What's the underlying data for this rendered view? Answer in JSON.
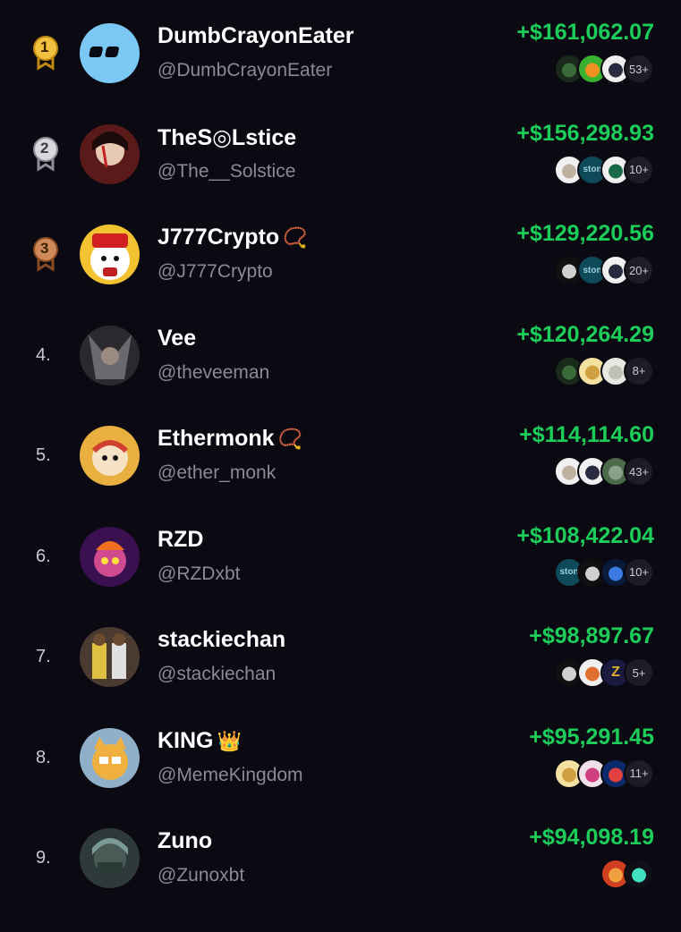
{
  "leaderboard": [
    {
      "rank": "1",
      "medal": "gold",
      "name": "DumbCrayonEater",
      "emoji": "",
      "handle": "@DumbCrayonEater",
      "pnl": "+$161,062.07",
      "avatar_color": "#7cc8f5",
      "tokens": [
        "dark-green-token-icon",
        "orange-green-token-icon",
        "cat-token-icon"
      ],
      "more": "53+"
    },
    {
      "rank": "2",
      "medal": "silver",
      "name": "TheS◎Lstice",
      "emoji": "",
      "handle": "@The__Solstice",
      "pnl": "+$156,298.93",
      "avatar_color": "#5a1a1a",
      "tokens": [
        "cat-white-token-icon",
        "ston-token-icon",
        "starbucks-cat-token-icon"
      ],
      "more": "10+"
    },
    {
      "rank": "3",
      "medal": "bronze",
      "name": "J777Crypto",
      "emoji": "📿",
      "handle": "@J777Crypto",
      "pnl": "+$129,220.56",
      "avatar_color": "#f2c230",
      "tokens": [
        "dark-figure-token-icon",
        "ston-token-icon",
        "cat-token-icon"
      ],
      "more": "20+"
    },
    {
      "rank": "4.",
      "medal": "",
      "name": "Vee",
      "emoji": "",
      "handle": "@theveeman",
      "pnl": "+$120,264.29",
      "avatar_color": "#2a2a2e",
      "tokens": [
        "dark-green-token-icon",
        "yellow-face-token-icon",
        "ghost-token-icon"
      ],
      "more": "8+"
    },
    {
      "rank": "5.",
      "medal": "",
      "name": "Ethermonk",
      "emoji": "📿",
      "handle": "@ether_monk",
      "pnl": "+$114,114.60",
      "avatar_color": "#e9b040",
      "tokens": [
        "cat-white-token-icon",
        "cat-token-icon",
        "green-frog-token-icon"
      ],
      "more": "43+"
    },
    {
      "rank": "6.",
      "medal": "",
      "name": "RZD",
      "emoji": "",
      "handle": "@RZDxbt",
      "pnl": "+$108,422.04",
      "avatar_color": "#3a1050",
      "tokens": [
        "ston-token-icon",
        "dark-figure-token-icon",
        "blue-figure-token-icon"
      ],
      "more": "10+"
    },
    {
      "rank": "7.",
      "medal": "",
      "name": "stackiechan",
      "emoji": "",
      "handle": "@stackiechan",
      "pnl": "+$98,897.67",
      "avatar_color": "#4a3a30",
      "tokens": [
        "dark-figure-token-icon",
        "orange-dog-token-icon",
        "gold-z-token-icon"
      ],
      "more": "5+"
    },
    {
      "rank": "8.",
      "medal": "",
      "name": "KING",
      "emoji": "👑",
      "handle": "@MemeKingdom",
      "pnl": "+$95,291.45",
      "avatar_color": "#8fb0c8",
      "tokens": [
        "yellow-face-token-icon",
        "pink-token-icon",
        "nyan-token-icon"
      ],
      "more": "11+"
    },
    {
      "rank": "9.",
      "medal": "",
      "name": "Zuno",
      "emoji": "",
      "handle": "@Zunoxbt",
      "pnl": "+$94,098.19",
      "avatar_color": "#2e3a3a",
      "tokens": [
        "red-planet-token-icon",
        "solana-token-icon"
      ],
      "more": ""
    }
  ]
}
